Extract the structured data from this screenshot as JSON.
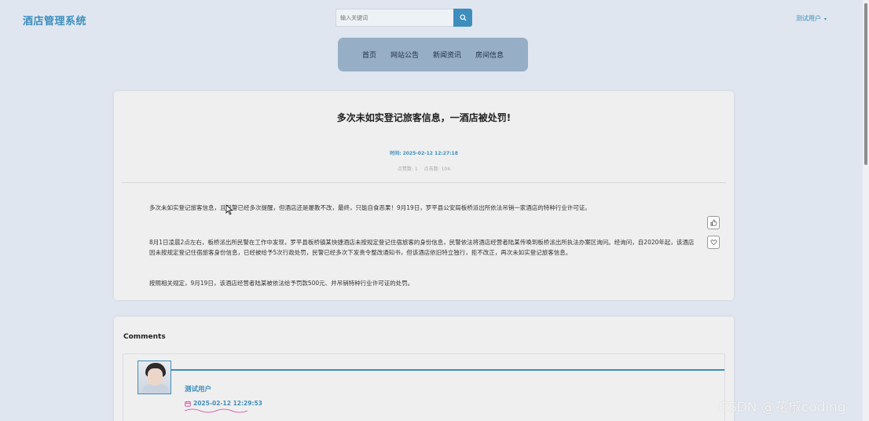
{
  "header": {
    "brand": "酒店管理系统",
    "search_placeholder": "输入关键词",
    "user_label": "测试用户",
    "caret": "▾"
  },
  "nav": [
    "首页",
    "网站公告",
    "新闻资讯",
    "房间信息"
  ],
  "article": {
    "title": "多次未如实登记旅客信息，一酒店被处罚!",
    "time_label": "时间: 2025-02-12 12:27:18",
    "likes_label": "点赞数: 1",
    "clicks_label": "点击数: 104",
    "paragraphs": [
      "多次未如实登记旅客信息，且民警已经多次提醒，但酒店还是屡教不改，最终，只能自食恶果！9月19日，罗平县公安局板桥派出所依法吊销一家酒店的特种行业许可证。",
      "8月1日凌晨2点左右，板桥派出所民警在工作中发现，罗平县板桥镇某快捷酒店未按规定登记住宿旅客的身份信息，民警依法将酒店经营者陆某传唤到板桥派出所执法办案区询问。经询问，自2020年起，该酒店因未按规定登记住宿旅客身份信息，已经被给予5次行政处罚，民警已经多次下发责令整改通知书，但该酒店依旧特立独行，拒不改正，再次未如实登记旅客信息。",
      "按照相关规定，9月19日，该酒店经营者陆某被依法给予罚款500元、并吊销特种行业许可证的处罚。"
    ]
  },
  "comments": {
    "heading": "Comments",
    "items": [
      {
        "author": "测试用户",
        "date": "2025-02-12 12:29:53"
      }
    ]
  },
  "watermark": "CSDN @花椒coding",
  "colors": {
    "accent": "#3d8ebd",
    "nav_bg": "#96aec6",
    "page_bg": "#dfe6ef"
  },
  "icons": [
    "search-icon",
    "thumb-up-icon",
    "heart-icon",
    "calendar-icon"
  ]
}
